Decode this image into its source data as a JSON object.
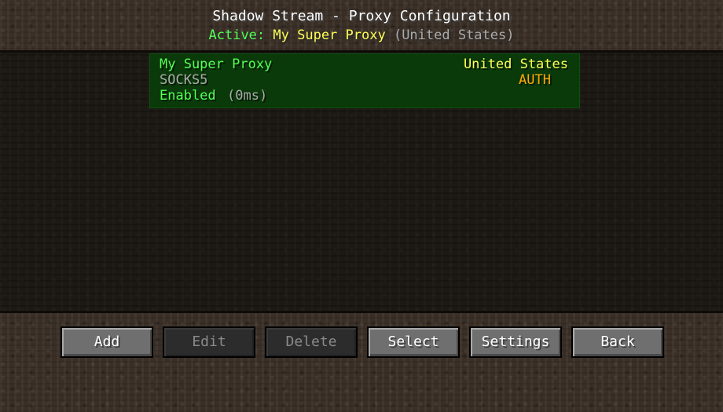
{
  "header": {
    "title": "Shadow Stream - Proxy Configuration",
    "active_label": "Active:",
    "active_proxy": "My Super Proxy",
    "active_country": "(United States)"
  },
  "proxies": [
    {
      "name": "My Super Proxy",
      "country": "United States",
      "type": "SOCKS5",
      "auth": "AUTH",
      "status": "Enabled",
      "ping": "(0ms)"
    }
  ],
  "buttons": {
    "add": "Add",
    "edit": "Edit",
    "delete": "Delete",
    "select": "Select",
    "settings": "Settings",
    "back": "Back"
  },
  "colors": {
    "active_green": "#55ff55",
    "proxy_yellow": "#ffff55",
    "muted_gray": "#aaaaaa",
    "auth_orange": "#ffaa00",
    "selected_row": "#0a3a0a"
  }
}
